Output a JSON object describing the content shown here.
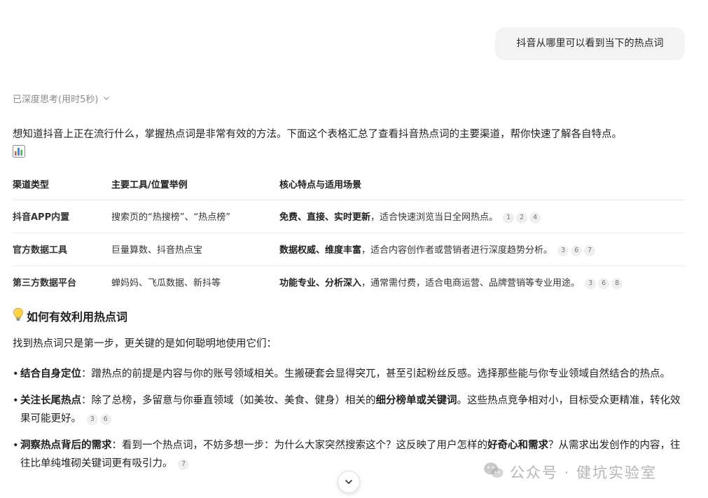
{
  "user_message": "抖音从哪里可以看到当下的热点词",
  "thinking": {
    "label": "已深度思考(用时5秒)",
    "icon": "chevron-down-icon"
  },
  "intro_text": "想知道抖音上正在流行什么，掌握热点词是非常有效的方法。下面这个表格汇总了查看抖音热点词的主要渠道，帮你快速了解各自特点。",
  "intro_icon": "bar-chart-emoji-icon",
  "table": {
    "headers": [
      "渠道类型",
      "主要工具/位置举例",
      "核心特点与适用场景"
    ],
    "rows": [
      {
        "type": "抖音APP内置",
        "tools": "搜索页的“热搜榜”、“热点榜”",
        "feature_bold": "免费、直接、实时更新",
        "feature_rest": "，适合快速浏览当日全网热点。",
        "cites": [
          "1",
          "2",
          "4"
        ]
      },
      {
        "type": "官方数据工具",
        "tools": "巨量算数、抖音热点宝",
        "feature_bold": "数据权威、维度丰富",
        "feature_rest": "，适合内容创作者或营销者进行深度趋势分析。",
        "cites": [
          "3",
          "6",
          "7"
        ]
      },
      {
        "type": "第三方数据平台",
        "tools": "蝉妈妈、飞瓜数据、新抖等",
        "feature_bold": "功能专业、分析深入",
        "feature_rest": "，通常需付费，适合电商运营、品牌营销等专业用途。",
        "cites": [
          "3",
          "6",
          "8"
        ]
      }
    ]
  },
  "section": {
    "icon": "lightbulb-icon",
    "title": "如何有效利用热点词",
    "lead": "找到热点词只是第一步，更关键的是如何聪明地使用它们："
  },
  "tips": [
    {
      "term": "结合自身定位",
      "text": "：蹭热点的前提是内容与你的账号领域相关。生搬硬套会显得突兀，甚至引起粉丝反感。选择那些能与你专业领域自然结合的热点。",
      "cites": []
    },
    {
      "term": "关注长尾热点",
      "text_a": "：除了总榜，多留意与你垂直领域（如美妆、美食、健身）相关的",
      "bold_mid": "细分榜单或关键词",
      "text_b": "。这些热点竞争相对小，目标受众更精准，转化效果可能更好。",
      "cites": [
        "3",
        "6"
      ]
    },
    {
      "term": "洞察热点背后的需求",
      "text_a": "：看到一个热点词，不妨多想一步：为什么大家突然搜索这个？这反映了用户怎样的",
      "bold_mid": "好奇心和需求",
      "text_b": "？从需求出发创作的内容，往往比单纯堆砌关键词更有吸引力。",
      "cites": [
        "7"
      ]
    }
  ],
  "scroll_button": {
    "icon": "chevron-down-icon"
  },
  "watermark": {
    "icon": "wechat-icon",
    "text": "公众号 · 健坑实验室"
  }
}
